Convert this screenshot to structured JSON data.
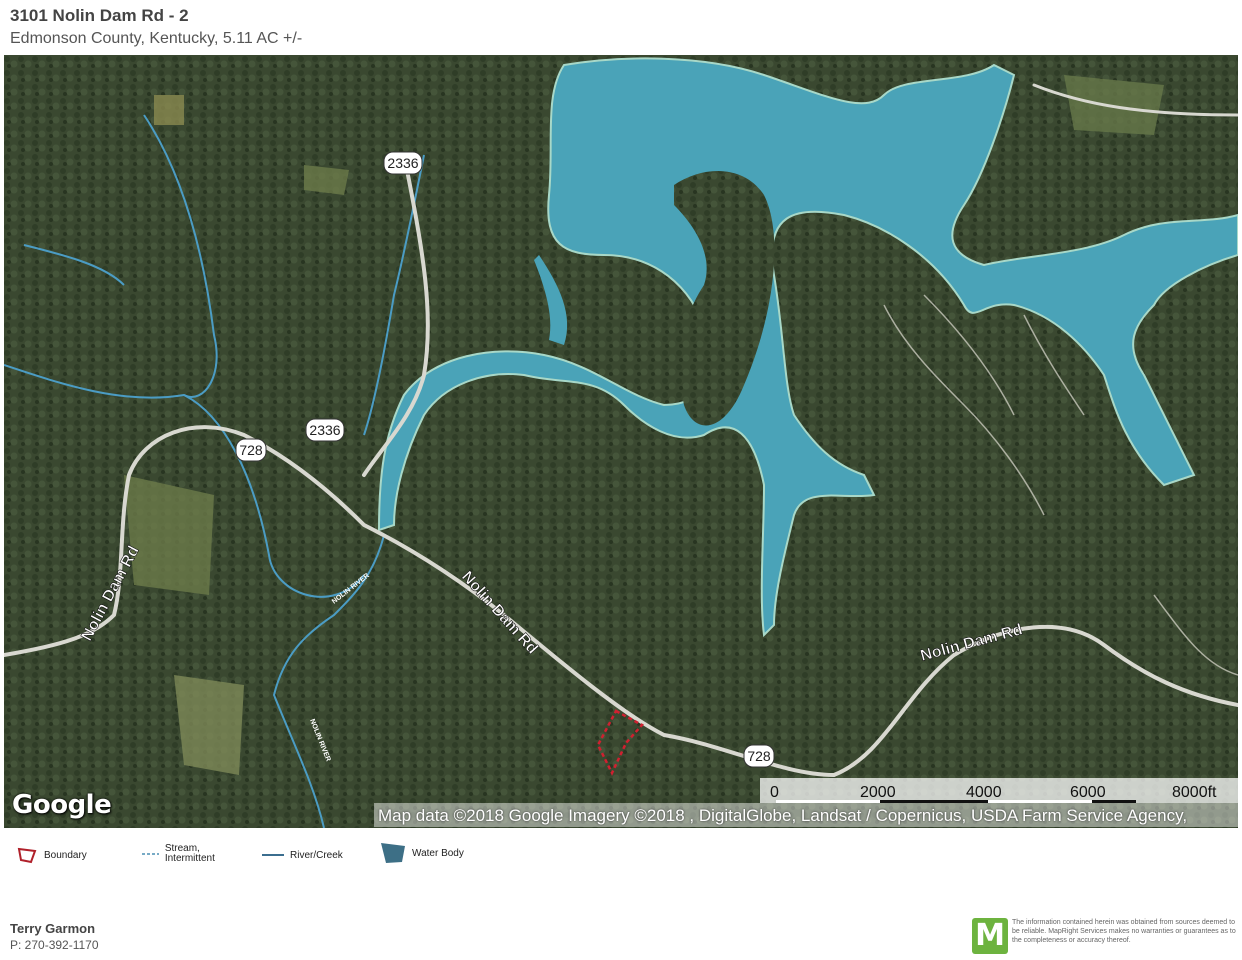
{
  "header": {
    "title": "3101 Nolin Dam Rd - 2",
    "subtitle": "Edmonson County, Kentucky, 5.11 AC +/-"
  },
  "map": {
    "road_labels": [
      "Nolin Dam Rd",
      "Nolin Dam Rd",
      "Nolin Dam Rd"
    ],
    "route_shields": [
      "2336",
      "2336",
      "728",
      "728"
    ],
    "river_labels": [
      "NOLIN RIVER",
      "NOLIN RIVER"
    ],
    "google_logo": "Google",
    "attribution": "Map data ©2018 Google  Imagery ©2018 , DigitalGlobe, Landsat / Copernicus, USDA Farm Service Agency,",
    "scale_labels": [
      "0",
      "2000",
      "4000",
      "6000",
      "8000ft"
    ],
    "colors": {
      "water": "#4aa3b8",
      "terrain": "#3c4a2e",
      "boundary": "#c0202a",
      "road": "#d8d8d0"
    }
  },
  "legend": {
    "items": [
      {
        "label": "Boundary",
        "icon": "boundary-icon"
      },
      {
        "label": "Stream, Intermittent",
        "icon": "stream-icon"
      },
      {
        "label": "River/Creek",
        "icon": "river-icon"
      },
      {
        "label": "Water Body",
        "icon": "water-body-icon"
      }
    ]
  },
  "footer": {
    "agent_name": "Terry Garmon",
    "agent_phone": "P: 270-392-1170",
    "logo_letter": "M",
    "disclaimer": "The information contained herein was obtained from sources deemed to be reliable. MapRight Services makes no warranties or guarantees as to the completeness or accuracy thereof."
  }
}
